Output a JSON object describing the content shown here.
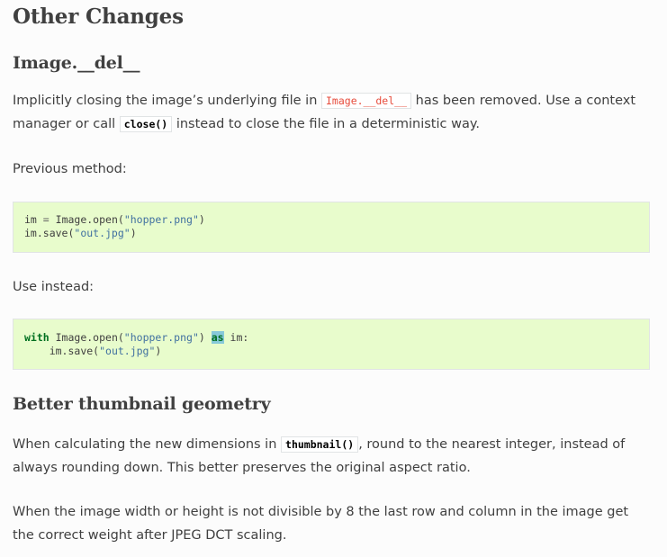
{
  "heading": "Other Changes",
  "section1": {
    "title": "Image.__del__",
    "para1": {
      "text_a": "Implicitly closing the image’s underlying file in ",
      "code_a": "Image.__del__",
      "text_b": " has been removed. Use a context manager or call ",
      "code_b": "close()",
      "text_c": " instead to close the file in a deterministic way."
    },
    "previous_label": "Previous method:",
    "code1": {
      "l1_a": "im ",
      "l1_eq": "=",
      "l1_b": " Image.open(",
      "l1_str": "\"hopper.png\"",
      "l1_c": ")",
      "l2_a": "im.save(",
      "l2_str": "\"out.jpg\"",
      "l2_b": ")"
    },
    "instead_label": "Use instead:",
    "code2": {
      "l1_kw": "with",
      "l1_a": " Image.open(",
      "l1_str": "\"hopper.png\"",
      "l1_b": ") ",
      "l1_as": "as",
      "l1_c": " im:",
      "l2_indent": "    ",
      "l2_a": "im.save(",
      "l2_str": "\"out.jpg\"",
      "l2_b": ")"
    }
  },
  "section2": {
    "title": "Better thumbnail geometry",
    "para1": {
      "text_a": "When calculating the new dimensions in ",
      "code_a": "thumbnail()",
      "text_b": ", round to the nearest integer, instead of always rounding down. This better preserves the original aspect ratio."
    },
    "para2": "When the image width or height is not divisible by 8 the last row and column in the image get the correct weight after JPEG DCT scaling."
  }
}
